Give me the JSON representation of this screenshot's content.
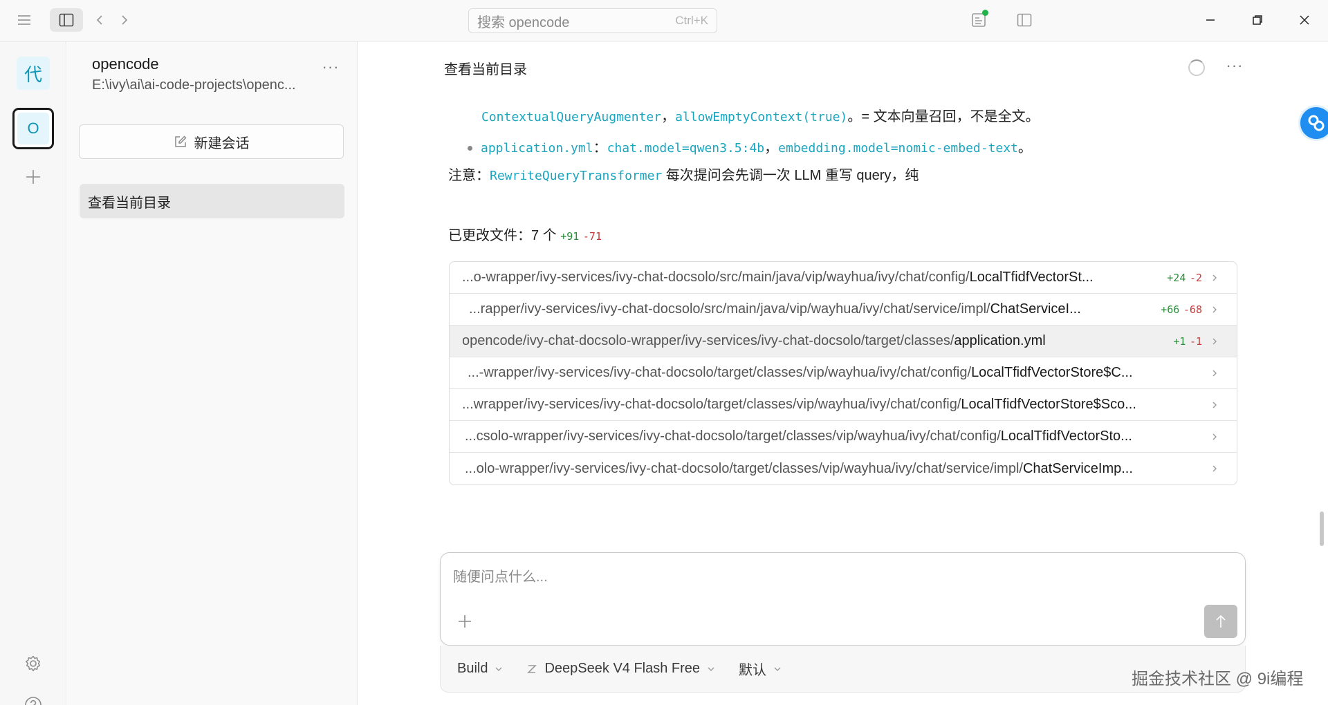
{
  "titlebar": {
    "search_placeholder": "搜索 opencode",
    "search_shortcut": "Ctrl+K"
  },
  "rail": {
    "avatar_label": "代",
    "project_label": "O"
  },
  "sessions": {
    "project_name": "opencode",
    "project_path": "E:\\ivy\\ai\\ai-code-projects\\openc...",
    "more": "···",
    "new_session_label": "新建会话",
    "items": [
      {
        "label": "查看当前目录"
      }
    ]
  },
  "main": {
    "session_title": "查看当前目录",
    "more": "···",
    "messages": {
      "line1_code_a": "ContextualQueryAugmenter",
      "line1_sep": "，",
      "line1_code_b": "allowEmptyContext(true)",
      "line1_text": "。= 文本向量召回，不是全文。",
      "line2_code_a": "application.yml",
      "line2_sep1": "：",
      "line2_code_b": "chat.model=qwen3.5:4b",
      "line2_sep2": "，",
      "line2_code_c": "embedding.model=nomic-embed-text",
      "line2_end": "。",
      "note_label": "注意：",
      "note_code": "RewriteQueryTransformer",
      "note_text": " 每次提问会先调一次 LLM 重写 query，纯"
    },
    "changed": {
      "label": "已更改文件：7 个",
      "added": "+91",
      "removed": "-71"
    },
    "files": [
      {
        "dir": "...o-wrapper/ivy-services/ivy-chat-docsolo/src/main/java/vip/wayhua/ivy/chat/config/",
        "name": "LocalTfidfVectorSt...",
        "added": "+24",
        "removed": "-2"
      },
      {
        "dir": "...rapper/ivy-services/ivy-chat-docsolo/src/main/java/vip/wayhua/ivy/chat/service/impl/",
        "name": "ChatServiceI...",
        "added": "+66",
        "removed": "-68"
      },
      {
        "dir": "opencode/ivy-chat-docsolo-wrapper/ivy-services/ivy-chat-docsolo/target/classes/",
        "name": "application.yml",
        "added": "+1",
        "removed": "-1"
      },
      {
        "dir": "...-wrapper/ivy-services/ivy-chat-docsolo/target/classes/vip/wayhua/ivy/chat/config/",
        "name": "LocalTfidfVectorStore$C...",
        "added": "",
        "removed": ""
      },
      {
        "dir": "...wrapper/ivy-services/ivy-chat-docsolo/target/classes/vip/wayhua/ivy/chat/config/",
        "name": "LocalTfidfVectorStore$Sco...",
        "added": "",
        "removed": ""
      },
      {
        "dir": "...csolo-wrapper/ivy-services/ivy-chat-docsolo/target/classes/vip/wayhua/ivy/chat/config/",
        "name": "LocalTfidfVectorSto...",
        "added": "",
        "removed": ""
      },
      {
        "dir": "...olo-wrapper/ivy-services/ivy-chat-docsolo/target/classes/vip/wayhua/ivy/chat/service/impl/",
        "name": "ChatServiceImp...",
        "added": "",
        "removed": ""
      }
    ]
  },
  "composer": {
    "placeholder": "随便问点什么...",
    "agent": "Build",
    "model": "DeepSeek V4 Flash Free",
    "variant": "默认"
  },
  "watermark": "掘金技术社区 @ 9i编程",
  "colors": {
    "accent_code": "#1aa5c0",
    "added": "#2a8f3a",
    "removed": "#c53b3b",
    "status_dot": "#21b24a"
  }
}
